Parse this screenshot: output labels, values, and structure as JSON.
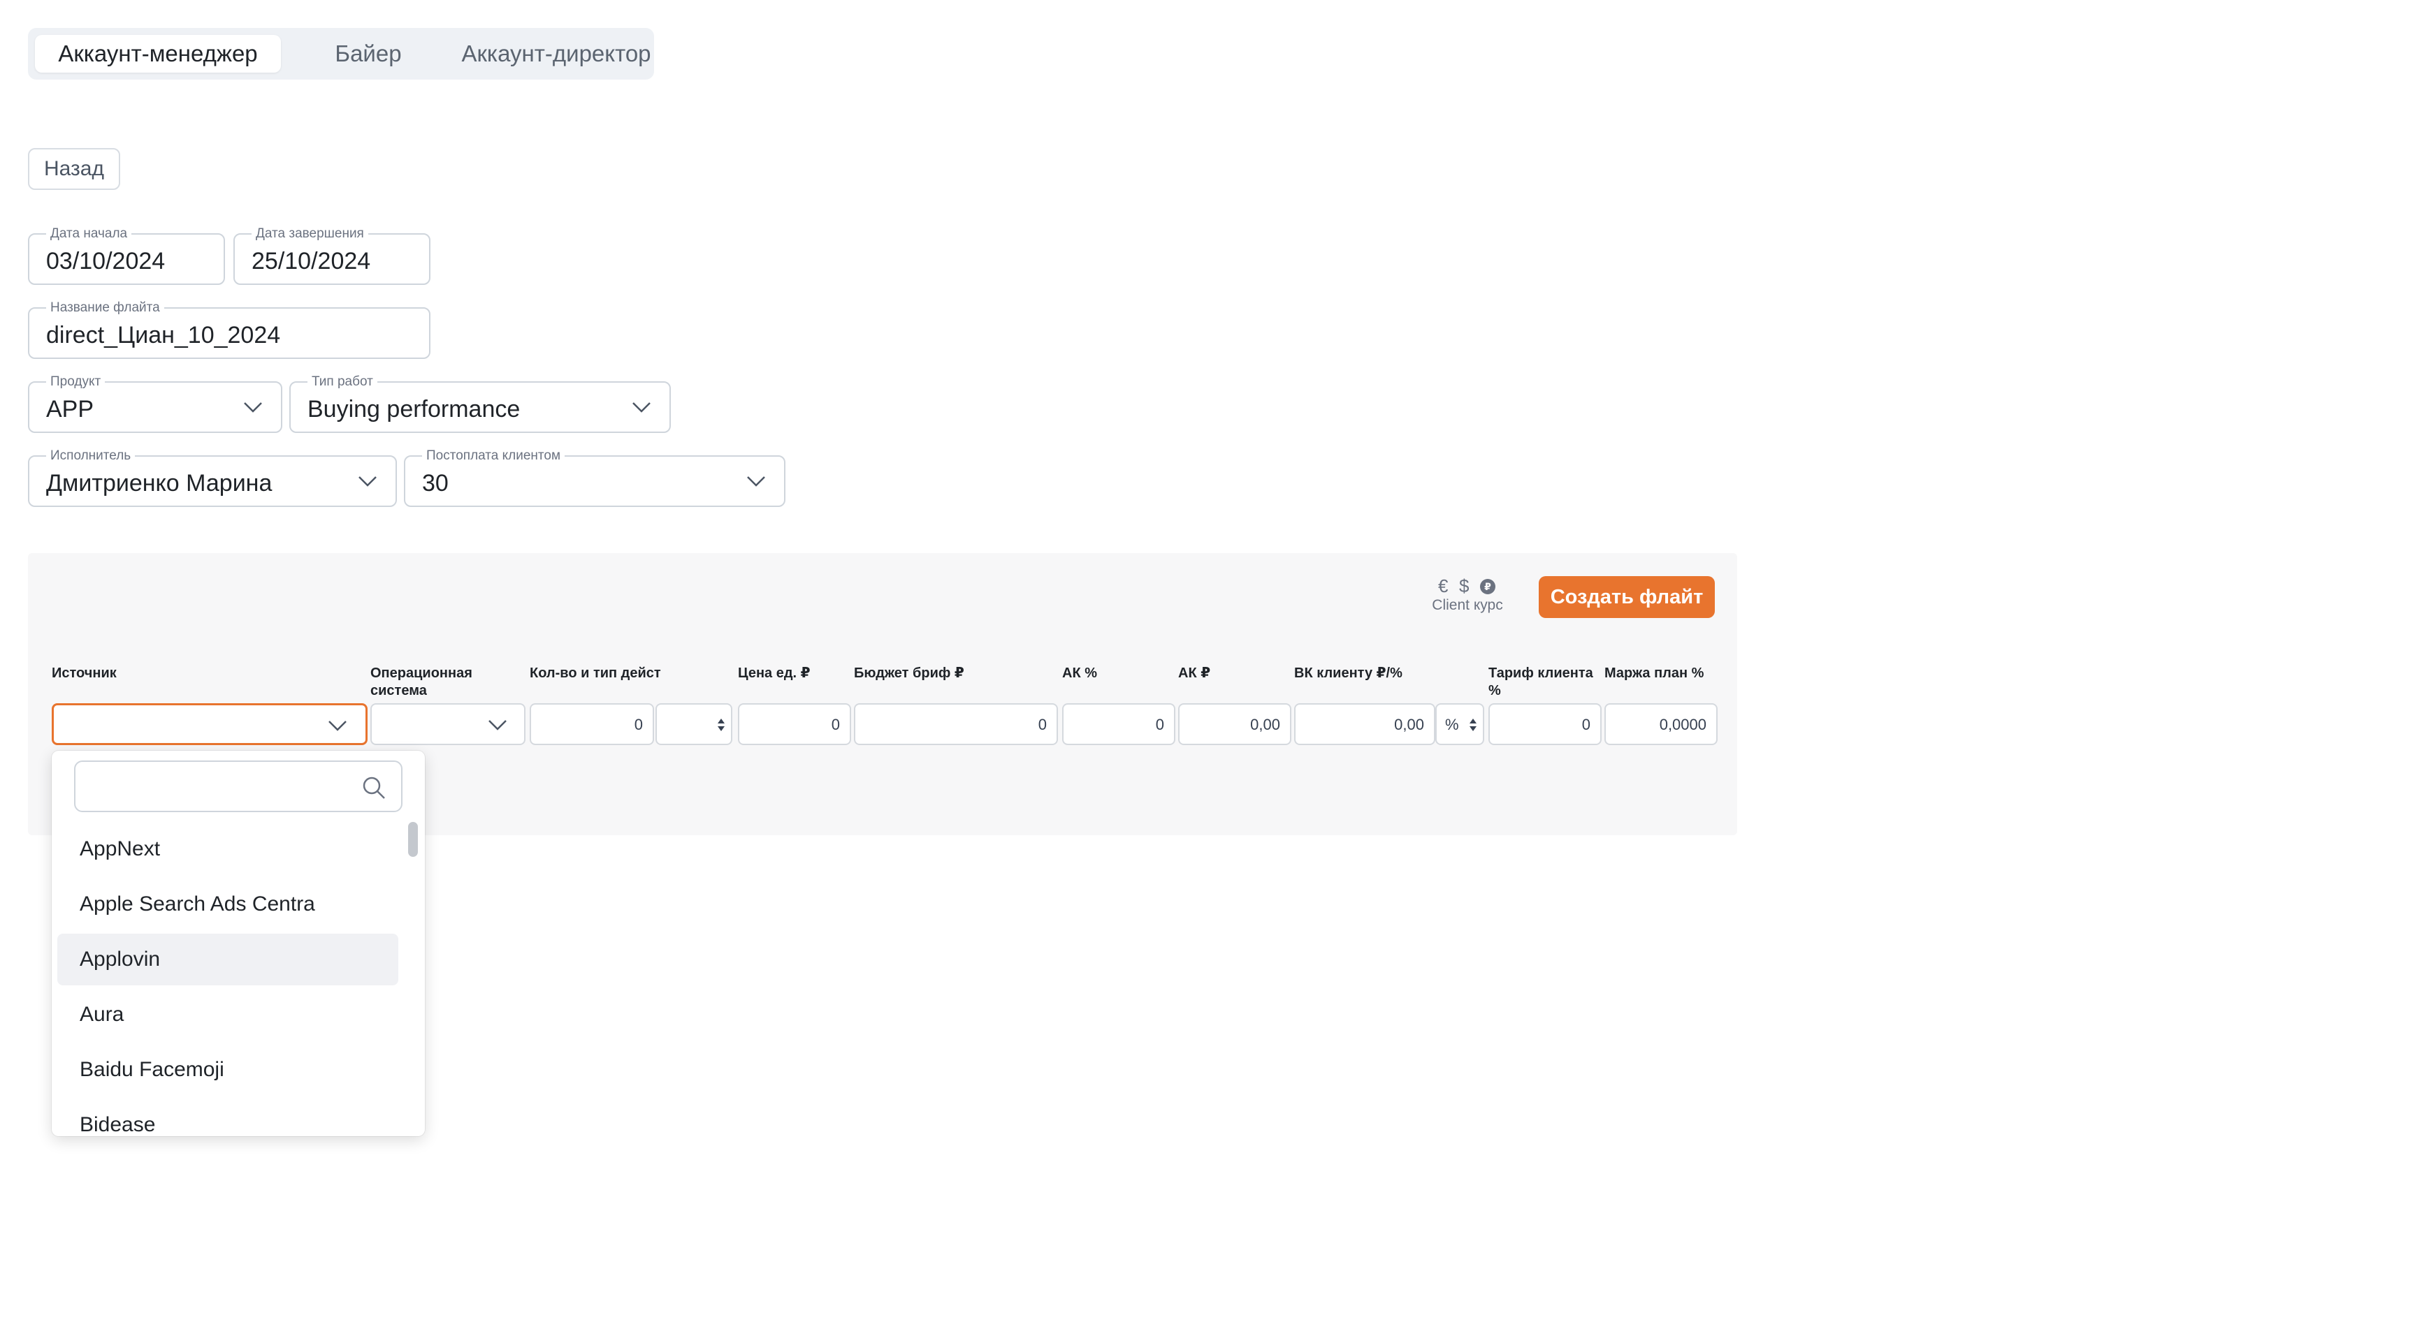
{
  "tabs": [
    "Аккаунт-менеджер",
    "Байер",
    "Аккаунт-директор"
  ],
  "active_tab": 0,
  "back_label": "Назад",
  "form": {
    "start_date": {
      "label": "Дата начала",
      "value": "03/10/2024"
    },
    "end_date": {
      "label": "Дата завершения",
      "value": "25/10/2024"
    },
    "flight_name": {
      "label": "Название флайта",
      "value": "direct_Циан_10_2024"
    },
    "product": {
      "label": "Продукт",
      "value": "APP"
    },
    "work_type": {
      "label": "Тип работ",
      "value": "Buying performance"
    },
    "executor": {
      "label": "Исполнитель",
      "value": "Дмитриенко Марина"
    },
    "postpay": {
      "label": "Постоплата клиентом",
      "value": "30"
    }
  },
  "panel": {
    "currency_symbols": [
      "€",
      "$"
    ],
    "currency_badge": "₽",
    "client_rate_label": "Client курс",
    "create_button": "Создать флайт",
    "columns": [
      "Источник",
      "Операционная система",
      "Кол-во и тип дейст",
      "Цена ед. ₽",
      "Бюджет бриф ₽",
      "АК %",
      "АК ₽",
      "ВК клиенту ₽/%",
      "Тариф клиента %",
      "Маржа план %"
    ],
    "row": {
      "qty": "0",
      "unit_price": "0",
      "budget": "0",
      "ak_percent": "0",
      "ak_rub": "0,00",
      "vk_value": "0,00",
      "vk_unit": "%",
      "tariff": "0",
      "margin": "0,0000"
    }
  },
  "dropdown": {
    "search_placeholder": "",
    "options": [
      "AppNext",
      "Apple Search Ads Centra",
      "Applovin",
      "Aura",
      "Baidu Facemoji",
      "Bidease"
    ],
    "highlighted": 2
  },
  "colors": {
    "accent": "#e8742e",
    "border": "#cfd5dc",
    "panel_bg": "#f7f7f8"
  }
}
